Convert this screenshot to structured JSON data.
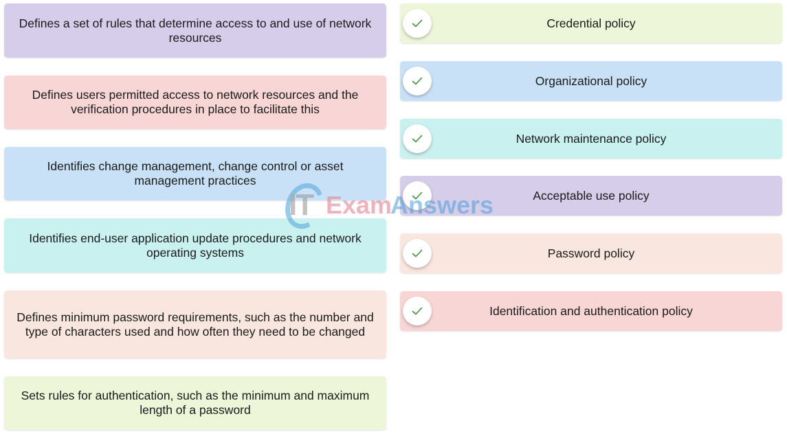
{
  "prompts": [
    {
      "text": "Defines a set of rules that determine access to and use of network resources",
      "color": "#d5cdea"
    },
    {
      "text": "Defines users permitted access to network resources and the verification procedures in place to facilitate this",
      "color": "#f8d6d6"
    },
    {
      "text": "Identifies change management, change control or asset management practices",
      "color": "#c9e1f7"
    },
    {
      "text": "Identifies end-user application update procedures and network operating systems",
      "color": "#c9f1f0"
    },
    {
      "text": "Defines minimum password requirements, such as the number and type of characters used and how often they need to be changed",
      "color": "#f9e7df"
    },
    {
      "text": "Sets rules for authentication, such as the minimum and maximum length of a password",
      "color": "#eef6d9"
    }
  ],
  "answers": [
    {
      "label": "Credential policy",
      "color": "#eef6d9",
      "status": "correct",
      "icon": "check-icon"
    },
    {
      "label": "Organizational policy",
      "color": "#c9e1f7",
      "status": "correct",
      "icon": "check-icon"
    },
    {
      "label": "Network maintenance policy",
      "color": "#c9f1f0",
      "status": "correct",
      "icon": "check-icon"
    },
    {
      "label": "Acceptable use policy",
      "color": "#d5cdea",
      "status": "correct",
      "icon": "check-icon"
    },
    {
      "label": "Password policy",
      "color": "#f9e7df",
      "status": "correct",
      "icon": "check-icon"
    },
    {
      "label": "Identification and authentication policy",
      "color": "#f8d6d6",
      "status": "correct",
      "icon": "check-icon"
    }
  ],
  "check_color": "#3f8f3a",
  "watermark": {
    "it": "IT",
    "exam": "Exam",
    "answers": "Answers"
  }
}
